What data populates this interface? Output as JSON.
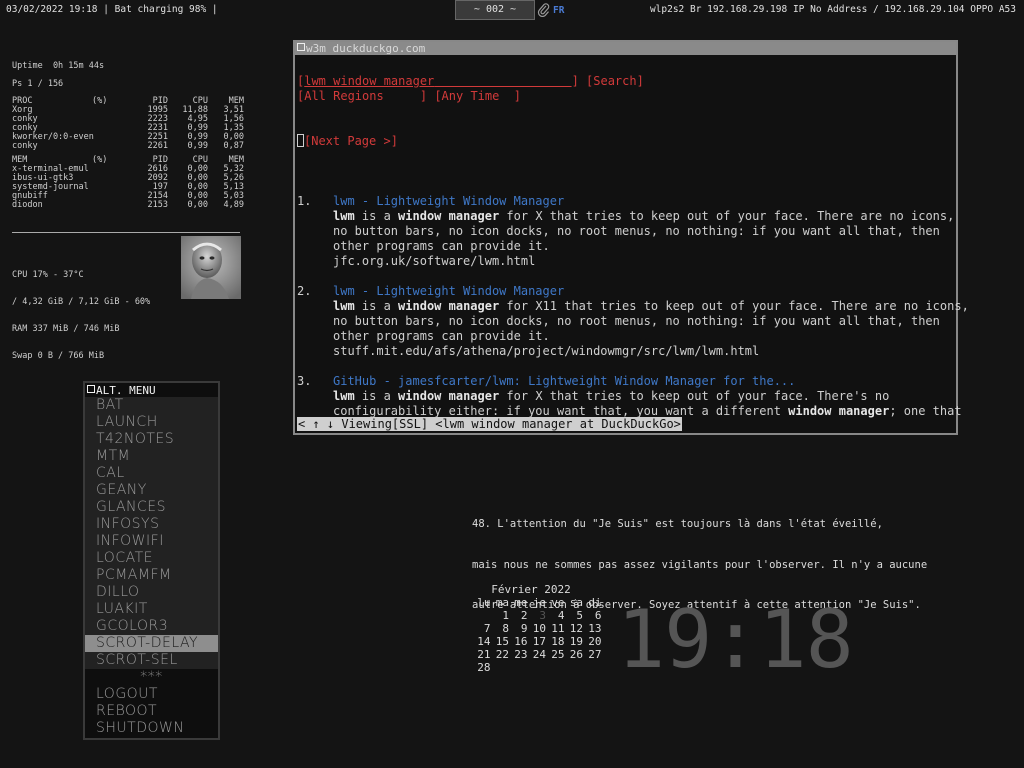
{
  "topbar": {
    "left_status": "03/02/2022 19:18 | Bat charging 98% |",
    "workspace": "~ 002 ~",
    "clip_icon": "paperclip-icon",
    "lang": "FR",
    "right_status": "wlp2s2 Br 192.168.29.198 IP No Address / 192.168.29.104 OPPO A53"
  },
  "conky": {
    "uptime": "Uptime  0h 15m 44s",
    "ps": "Ps 1 / 156",
    "proc_header": [
      "PROC",
      "(%)",
      "PID",
      "CPU",
      "MEM"
    ],
    "proc_rows": [
      [
        "Xorg",
        "1995",
        "11,88",
        "3,51"
      ],
      [
        "conky",
        "2223",
        "4,95",
        "1,56"
      ],
      [
        "conky",
        "2231",
        "0,99",
        "1,35"
      ],
      [
        "kworker/0:0-even",
        "2251",
        "0,99",
        "0,00"
      ],
      [
        "conky",
        "2261",
        "0,99",
        "0,87"
      ]
    ],
    "mem_header": [
      "MEM",
      "(%)",
      "PID",
      "CPU",
      "MEM"
    ],
    "mem_rows": [
      [
        "x-terminal-emul",
        "2616",
        "0,00",
        "5,32"
      ],
      [
        "ibus-ui-gtk3",
        "2092",
        "0,00",
        "5,26"
      ],
      [
        "systemd-journal",
        "197",
        "0,00",
        "5,13"
      ],
      [
        "gnubiff",
        "2154",
        "0,00",
        "5,03"
      ],
      [
        "diodon",
        "2153",
        "0,00",
        "4,89"
      ]
    ],
    "cpu_line": "CPU 17% - 37°C",
    "ram_total_line": "/ 4,32 GiB / 7,12 GiB - 60%",
    "ram_line": "RAM 337 MiB / 746 MiB",
    "swap_line": "Swap 0 B / 766 MiB"
  },
  "menu": {
    "title": "ALT. MENU",
    "items": [
      "BAT",
      "LAUNCH",
      "T42NOTES",
      "MTM",
      "CAL",
      "GEANY",
      "GLANCES",
      "INFOSYS",
      "INFOWIFI",
      "LOCATE",
      "PCMAMFM",
      "DILLO",
      "LUAKIT",
      "GCOLOR3",
      "SCROT-DELAY",
      "SCROT-SEL",
      "***",
      "LOGOUT",
      "REBOOT",
      "SHUTDOWN"
    ],
    "selected": "SCROT-DELAY"
  },
  "w3m": {
    "title": "w3m duckduckgo.com",
    "search_value": "lwm window manager",
    "search_button": "[Search]",
    "region": "All Regions",
    "time": "Any Time",
    "next_page": "[Next Page >]",
    "results": [
      {
        "num": "1.",
        "title": "lwm - Lightweight Window Manager",
        "snippet": [
          [
            [
              "b",
              "lwm"
            ],
            [
              "t",
              " is a "
            ],
            [
              "b",
              "window manager"
            ],
            [
              "t",
              " for X that tries to keep out of your face. There are no icons,"
            ]
          ],
          [
            [
              "t",
              "no button bars, no icon docks, no root menus, no nothing: if you want all that, then"
            ]
          ],
          [
            [
              "t",
              "other programs can provide it."
            ]
          ]
        ],
        "url": "jfc.org.uk/software/lwm.html"
      },
      {
        "num": "2.",
        "title": "lwm - Lightweight Window Manager",
        "snippet": [
          [
            [
              "b",
              "lwm"
            ],
            [
              "t",
              " is a "
            ],
            [
              "b",
              "window manager"
            ],
            [
              "t",
              " for X11 that tries to keep out of your face. There are no icons,"
            ]
          ],
          [
            [
              "t",
              "no button bars, no icon docks, no root menus, no nothing: if you want all that, then"
            ]
          ],
          [
            [
              "t",
              "other programs can provide it."
            ]
          ]
        ],
        "url": "stuff.mit.edu/afs/athena/project/windowmgr/src/lwm/lwm.html"
      },
      {
        "num": "3.",
        "title": "GitHub - jamesfcarter/lwm: Lightweight Window Manager for the...",
        "snippet": [
          [
            [
              "b",
              "lwm"
            ],
            [
              "t",
              " is a "
            ],
            [
              "b",
              "window manager"
            ],
            [
              "t",
              " for X that tries to keep out of your face. There's no"
            ]
          ],
          [
            [
              "t",
              "configurability either: if you want that, you want a different "
            ],
            [
              "b",
              "window manager"
            ],
            [
              "t",
              "; one that"
            ]
          ]
        ],
        "url": ""
      }
    ],
    "status": "< ↑ ↓ Viewing[SSL] <lwm window manager at DuckDuckGo>"
  },
  "quote": {
    "lines": [
      "48. L'attention du \"Je Suis\" est toujours là dans l'état éveillé,",
      "mais nous ne sommes pas assez vigilants pour l'observer. Il n'y a aucune",
      "autre attention à observer. Soyez attentif à cette attention \"Je Suis\"."
    ]
  },
  "calendar": {
    "title": "Février 2022",
    "weekdays": [
      "lu",
      "ma",
      "me",
      "je",
      "ve",
      "sa",
      "di"
    ],
    "weeks": [
      [
        "",
        "1",
        "2",
        "3",
        "4",
        "5",
        "6"
      ],
      [
        "7",
        "8",
        "9",
        "10",
        "11",
        "12",
        "13"
      ],
      [
        "14",
        "15",
        "16",
        "17",
        "18",
        "19",
        "20"
      ],
      [
        "21",
        "22",
        "23",
        "24",
        "25",
        "26",
        "27"
      ],
      [
        "28",
        "",
        "",
        "",
        "",
        "",
        ""
      ]
    ],
    "today": "3"
  },
  "clock": {
    "time": "19:18"
  },
  "colors": {
    "background": "#141414",
    "link_blue": "#3f78c8",
    "form_red": "#d23a3a",
    "lang_blue": "#4a7bd4",
    "menu_selected": "#8e8e8e"
  }
}
